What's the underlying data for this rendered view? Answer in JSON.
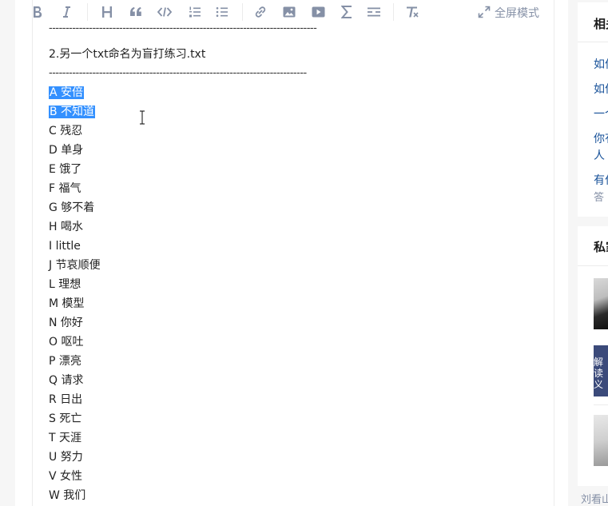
{
  "toolbar": {
    "fullscreen_label": "全屏模式",
    "icons": [
      "bold-icon",
      "italic-icon",
      "heading-icon",
      "quote-icon",
      "code-icon",
      "ordered-list-icon",
      "unordered-list-icon",
      "link-icon",
      "image-icon",
      "video-icon",
      "formula-icon",
      "divider-icon",
      "clear-format-icon",
      "fullscreen-icon"
    ]
  },
  "document": {
    "dash_line_top": "--------------------------------------------------------------------------------",
    "file_heading": "2.另一个txt命名为盲打练习.txt",
    "dash_line_2": "-----------------------------------------------------------------------------",
    "lines": [
      "A 安倍",
      "B 不知道",
      "C 残忍",
      "D 单身",
      "E 饿了",
      "F 福气",
      "G 够不着",
      "H 喝水",
      "I little",
      "J 节哀顺便",
      "L 理想",
      "M 模型",
      "N 你好",
      "O 呕吐",
      "P 漂亮",
      "Q 请求",
      "R 日出",
      "S 死亡",
      "T 天涯",
      "U 努力",
      "V 女性",
      "W 我们"
    ],
    "selected_lines": [
      0,
      1
    ]
  },
  "sidebar": {
    "related_title": "相关",
    "related_links": [
      "如何",
      "如何",
      "一个",
      "你有",
      "人",
      "有什",
      "答"
    ],
    "private_title": "私家",
    "thumb2_text": "解读",
    "thumb2_text2": "义",
    "footer_text": "刘看山"
  },
  "colors": {
    "selection": "#3390ff",
    "link": "#175199",
    "icon": "#8590a6"
  }
}
